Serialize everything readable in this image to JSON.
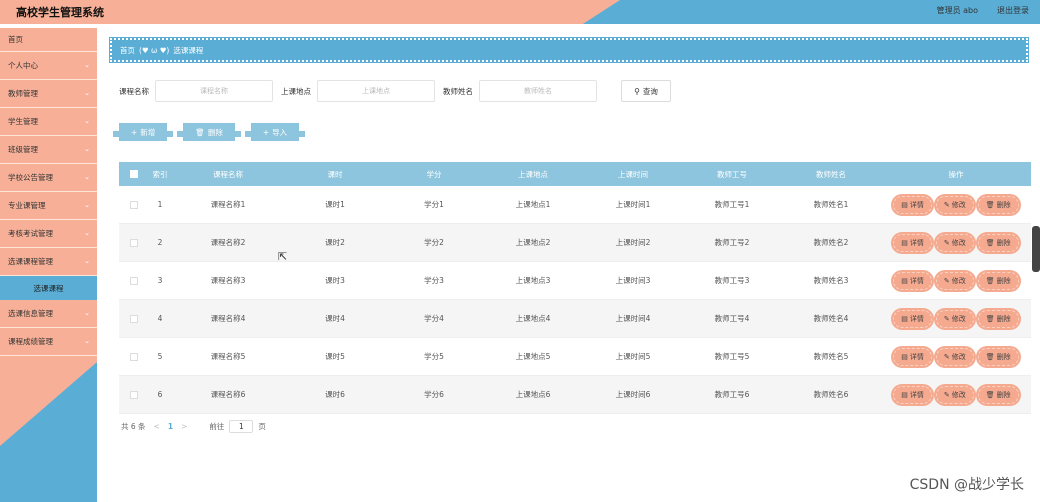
{
  "app": {
    "title": "高校学生管理系统",
    "admin_label": "管理员 abo",
    "logout_label": "退出登录"
  },
  "sidebar": {
    "items": [
      {
        "label": "首页",
        "has_children": false
      },
      {
        "label": "个人中心",
        "has_children": true
      },
      {
        "label": "教师管理",
        "has_children": true
      },
      {
        "label": "学生管理",
        "has_children": true
      },
      {
        "label": "班级管理",
        "has_children": true
      },
      {
        "label": "学校公告管理",
        "has_children": true
      },
      {
        "label": "专业课管理",
        "has_children": true
      },
      {
        "label": "考核考试管理",
        "has_children": true
      },
      {
        "label": "选课课程管理",
        "has_children": true
      }
    ],
    "sub_active": "选课课程",
    "items_after": [
      {
        "label": "选课信息管理",
        "has_children": true
      },
      {
        "label": "课程成绩管理",
        "has_children": true
      }
    ],
    "chevron_icon": "chevron-down-icon"
  },
  "breadcrumb": {
    "home": "首页",
    "separator": "(♥ ω ♥)",
    "current": "选课课程"
  },
  "search": {
    "fields": [
      {
        "label": "课程名称",
        "placeholder": "课程名称"
      },
      {
        "label": "上课地点",
        "placeholder": "上课地点"
      },
      {
        "label": "教师姓名",
        "placeholder": "教师姓名"
      }
    ],
    "button_label": "查询",
    "button_icon": "search-icon"
  },
  "toolbar": {
    "add_label": "新增",
    "add_icon": "plus-icon",
    "delete_label": "删除",
    "delete_icon": "trash-icon",
    "import_label": "导入",
    "import_icon": "plus-icon"
  },
  "table": {
    "headers": [
      "索引",
      "课程名称",
      "课时",
      "学分",
      "上课地点",
      "上课时间",
      "教师工号",
      "教师姓名",
      "操作"
    ],
    "rows": [
      {
        "idx": "1",
        "name": "课程名称1",
        "hour": "课时1",
        "credit": "学分1",
        "place": "上课地点1",
        "time": "上课时间1",
        "tno": "教师工号1",
        "tname": "教师姓名1"
      },
      {
        "idx": "2",
        "name": "课程名称2",
        "hour": "课时2",
        "credit": "学分2",
        "place": "上课地点2",
        "time": "上课时间2",
        "tno": "教师工号2",
        "tname": "教师姓名2"
      },
      {
        "idx": "3",
        "name": "课程名称3",
        "hour": "课时3",
        "credit": "学分3",
        "place": "上课地点3",
        "time": "上课时间3",
        "tno": "教师工号3",
        "tname": "教师姓名3"
      },
      {
        "idx": "4",
        "name": "课程名称4",
        "hour": "课时4",
        "credit": "学分4",
        "place": "上课地点4",
        "time": "上课时间4",
        "tno": "教师工号4",
        "tname": "教师姓名4"
      },
      {
        "idx": "5",
        "name": "课程名称5",
        "hour": "课时5",
        "credit": "学分5",
        "place": "上课地点5",
        "time": "上课时间5",
        "tno": "教师工号5",
        "tname": "教师姓名5"
      },
      {
        "idx": "6",
        "name": "课程名称6",
        "hour": "课时6",
        "credit": "学分6",
        "place": "上课地点6",
        "time": "上课时间6",
        "tno": "教师工号6",
        "tname": "教师姓名6"
      }
    ],
    "op_labels": {
      "detail": "详情",
      "edit": "修改",
      "delete": "删除"
    },
    "op_icons": {
      "detail": "document-icon",
      "edit": "pencil-icon",
      "delete": "trash-icon"
    }
  },
  "pager": {
    "total": "共 6 条",
    "prev": "<",
    "page": "1",
    "next": ">",
    "goto_label": "前往",
    "goto_value": "1",
    "goto_suffix": "页"
  },
  "watermark": "CSDN @战少学长",
  "colors": {
    "peach": "#f7b097",
    "blue": "#5aaed6",
    "table_header": "#8ec5de",
    "op_button": "#f5a98f"
  }
}
